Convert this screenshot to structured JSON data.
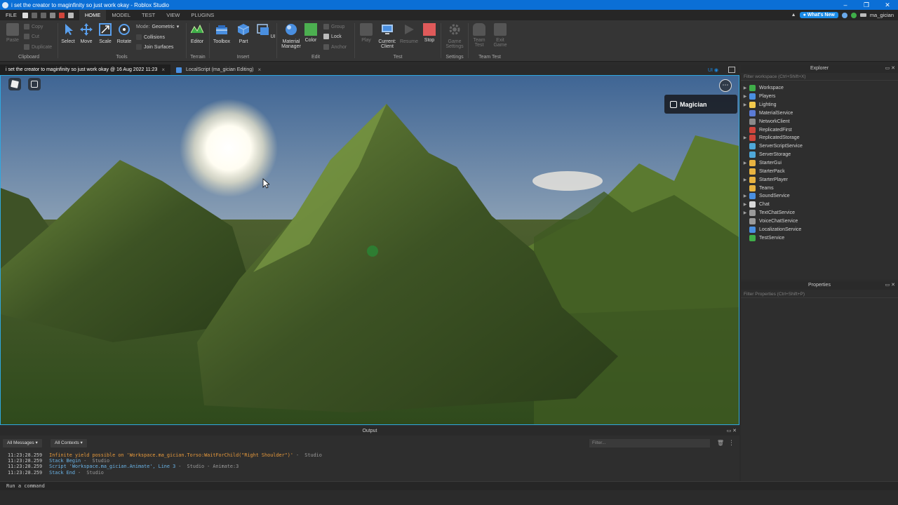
{
  "window": {
    "title": "i set the creator to maginfinity so just work okay - Roblox Studio",
    "controls": [
      "–",
      "❐",
      "✕"
    ]
  },
  "menu": {
    "file": "FILE",
    "tabs": [
      "HOME",
      "MODEL",
      "TEST",
      "VIEW",
      "PLUGINS"
    ],
    "whats_new": "What's New",
    "username": "ma_gician"
  },
  "ribbon": {
    "clipboard": {
      "label": "Clipboard",
      "paste": "Paste",
      "copy": "Copy",
      "cut": "Cut",
      "duplicate": "Duplicate"
    },
    "tools": {
      "label": "Tools",
      "select": "Select",
      "move": "Move",
      "scale": "Scale",
      "rotate": "Rotate",
      "mode_label": "Mode:",
      "mode_value": "Geometric",
      "collisions": "Collisions",
      "join_surfaces": "Join Surfaces"
    },
    "terrain": {
      "label": "Terrain",
      "editor": "Editor"
    },
    "insert": {
      "label": "Insert",
      "toolbox": "Toolbox",
      "part": "Part",
      "ui": "UI"
    },
    "edit": {
      "label": "Edit",
      "material": "Material",
      "manager": "Manager",
      "color": "Color",
      "group": "Group",
      "lock": "Lock",
      "anchor": "Anchor"
    },
    "test": {
      "label": "Test",
      "play": "Play",
      "current": "Current:",
      "client": "Client",
      "resume": "Resume",
      "stop": "Stop"
    },
    "settings": {
      "label": "Settings",
      "game": "Game",
      "settings": "Settings"
    },
    "team_test": {
      "label": "Team Test",
      "team": "Team",
      "test": "Test",
      "exit": "Exit",
      "game": "Game"
    }
  },
  "doc_tabs": [
    {
      "label": "i set the creator to maginfinity so just work okay @ 16 Aug 2022 11:23"
    },
    {
      "label": "LocalScript (ma_gician Editing)"
    }
  ],
  "viewport": {
    "ui_flag": "UI",
    "player_name": "Magician",
    "more": "⋯"
  },
  "explorer": {
    "title": "Explorer",
    "filter_placeholder": "Filter workspace (Ctrl+Shift+X)",
    "items": [
      {
        "name": "Workspace",
        "expandable": true,
        "color": "#3fae49"
      },
      {
        "name": "Players",
        "expandable": true,
        "color": "#4a8fe0"
      },
      {
        "name": "Lighting",
        "expandable": true,
        "color": "#f2c94c"
      },
      {
        "name": "MaterialService",
        "expandable": false,
        "color": "#5b7bd5"
      },
      {
        "name": "NetworkClient",
        "expandable": false,
        "color": "#8a8a8a"
      },
      {
        "name": "ReplicatedFirst",
        "expandable": false,
        "color": "#d0453b"
      },
      {
        "name": "ReplicatedStorage",
        "expandable": true,
        "color": "#d0453b"
      },
      {
        "name": "ServerScriptService",
        "expandable": false,
        "color": "#4fa8d9"
      },
      {
        "name": "ServerStorage",
        "expandable": false,
        "color": "#4fa8d9"
      },
      {
        "name": "StarterGui",
        "expandable": true,
        "color": "#e8b340"
      },
      {
        "name": "StarterPack",
        "expandable": false,
        "color": "#e8b340"
      },
      {
        "name": "StarterPlayer",
        "expandable": true,
        "color": "#e8b340"
      },
      {
        "name": "Teams",
        "expandable": false,
        "color": "#e8b340"
      },
      {
        "name": "SoundService",
        "expandable": true,
        "color": "#4a8fe0"
      },
      {
        "name": "Chat",
        "expandable": true,
        "color": "#d8d8d8"
      },
      {
        "name": "TextChatService",
        "expandable": true,
        "color": "#9a9a9a"
      },
      {
        "name": "VoiceChatService",
        "expandable": false,
        "color": "#9a9a9a"
      },
      {
        "name": "LocalizationService",
        "expandable": false,
        "color": "#4a8fe0"
      },
      {
        "name": "TestService",
        "expandable": false,
        "color": "#3fae49"
      }
    ]
  },
  "properties": {
    "title": "Properties",
    "filter_placeholder": "Filter Properties (Ctrl+Shift+P)"
  },
  "output": {
    "title": "Output",
    "messages_dropdown": "All Messages",
    "contexts_dropdown": "All Contexts",
    "filter_placeholder": "Filter...",
    "logs": [
      {
        "time": "11:23:28.259",
        "text": "Infinite yield possible on 'Workspace.ma_gician.Torso:WaitForChild(\"Right Shoulder\")'",
        "source": " -  Studio",
        "kind": "warn"
      },
      {
        "time": "11:23:28.259",
        "text": "Stack Begin",
        "source": " -  Studio",
        "kind": "info"
      },
      {
        "time": "11:23:28.259",
        "text": "Script 'Workspace.ma_gician.Animate', Line 3",
        "source": " -  Studio - Animate:3",
        "kind": "info"
      },
      {
        "time": "11:23:28.259",
        "text": "Stack End",
        "source": " -  Studio",
        "kind": "info"
      }
    ]
  },
  "command_bar": {
    "placeholder": "Run a command"
  },
  "colors": {
    "accent": "#0b6fd6",
    "viewport_border": "#2ea8e0",
    "warn": "#e89a3c",
    "info": "#6ab4e8"
  }
}
